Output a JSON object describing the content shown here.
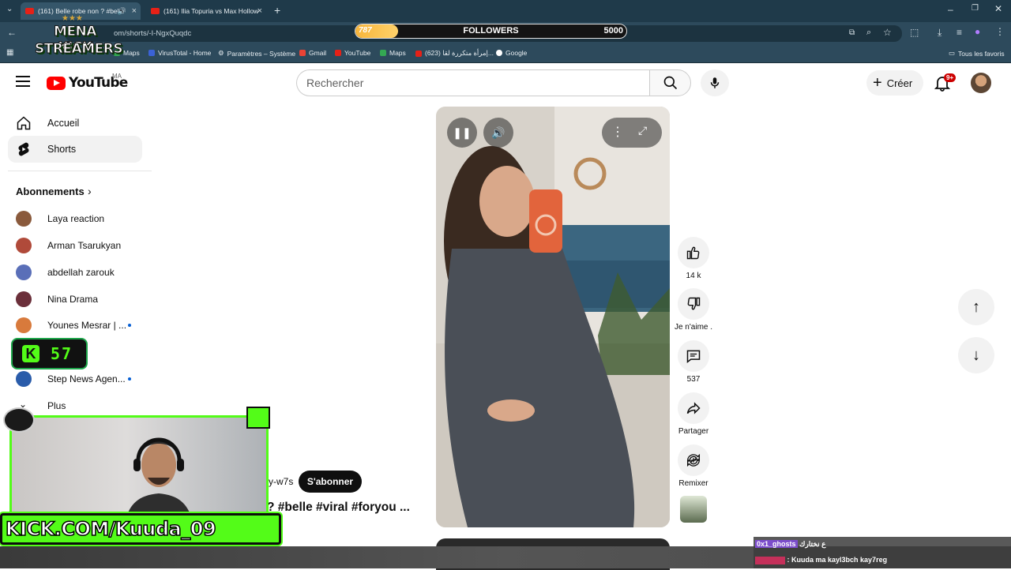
{
  "browser": {
    "tabs": [
      {
        "title": "(161) Belle robe non ? #belle"
      },
      {
        "title": "(161) Ilia Topuria vs Max Hollow"
      }
    ],
    "new_tab_symbol": "+",
    "url": "om/shorts/-I-NgxQuqdc",
    "bookmarks": [
      "Maps",
      "VirusTotal - Home",
      "Paramètres – Système",
      "Gmail",
      "YouTube",
      "Maps",
      "(623) إمرأة متكررة لقا...",
      "Google"
    ],
    "all_bookmarks": "Tous les favoris"
  },
  "stream_overlay": {
    "logo_line1": "MENA KICK",
    "logo_line2": "STREAMERS",
    "followers_current": "787",
    "followers_label": "FOLLOWERS",
    "followers_goal": "5000",
    "followers_progress": 0.1574,
    "kick_counter_letter": "K",
    "kick_counter_value": "57",
    "kick_banner": "KICK.COM/Kuuda_09",
    "chat": [
      {
        "user": "0x1_ghosts",
        "message": "ع نختارك"
      },
      {
        "user": "",
        "message": ": Kuuda ma kayl3bch kay7reg"
      }
    ],
    "colors": {
      "kick_green": "#53fc18",
      "followers_fill": "#f7b53b"
    }
  },
  "youtube": {
    "logo_text": "YouTube",
    "region": "MA",
    "search_placeholder": "Rechercher",
    "create_label": "Créer",
    "notification_badge": "9+",
    "nav": [
      {
        "label": "Accueil",
        "icon": "home-icon"
      },
      {
        "label": "Shorts",
        "icon": "shorts-icon"
      }
    ],
    "subscriptions_title": "Abonnements",
    "subscriptions": [
      {
        "name": "Laya reaction",
        "dot": false,
        "color": "#8a5a3c"
      },
      {
        "name": "Arman Tsarukyan",
        "dot": false,
        "color": "#b04a3a"
      },
      {
        "name": "abdellah zarouk",
        "dot": false,
        "color": "#5a6fb8"
      },
      {
        "name": "Nina Drama",
        "dot": false,
        "color": "#6b2f3a"
      },
      {
        "name": "Younes Mesrar | ...",
        "dot": true,
        "color": "#d87a3c"
      },
      {
        "name": "Step News Agen...",
        "dot": true,
        "color": "#2a5caa"
      }
    ],
    "more_label": "Plus",
    "channel_handle": "y-w7s",
    "subscribe_label": "S'abonner",
    "caption": "? #belle #viral #foryou ...",
    "actions": [
      {
        "icon": "like-icon",
        "label": "14 k"
      },
      {
        "icon": "dislike-icon",
        "label": "Je n'aime ."
      },
      {
        "icon": "comment-icon",
        "label": "537"
      },
      {
        "icon": "share-icon",
        "label": "Partager"
      },
      {
        "icon": "remix-icon",
        "label": "Remixer"
      }
    ]
  }
}
